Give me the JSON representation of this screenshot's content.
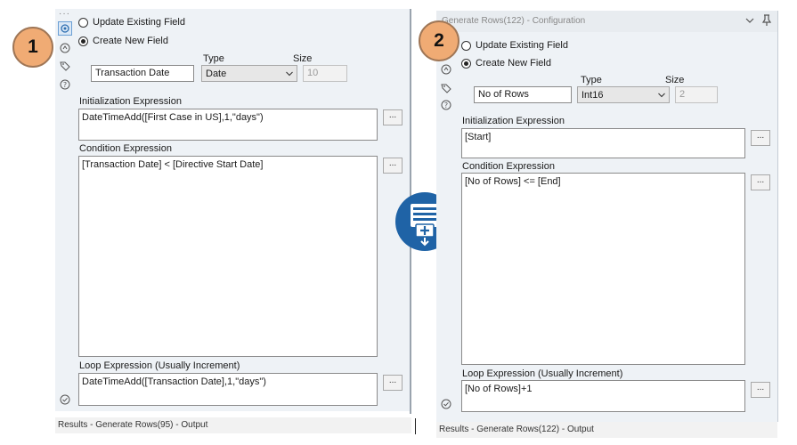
{
  "left": {
    "badge": "1",
    "radio_update": "Update Existing Field",
    "radio_create": "Create New  Field",
    "type_label": "Type",
    "size_label": "Size",
    "field_name": "Transaction Date",
    "type_value": "Date",
    "size_value": "10",
    "init_label": "Initialization Expression",
    "init_value": "DateTimeAdd([First Case in US],1,\"days\")",
    "cond_label": "Condition Expression",
    "cond_value": "[Transaction Date] < [Directive Start Date]",
    "loop_label": "Loop Expression (Usually Increment)",
    "loop_value": "DateTimeAdd([Transaction Date],1,\"days\")",
    "button_label": "...",
    "status": "Results - Generate Rows(95) - Output"
  },
  "right": {
    "badge": "2",
    "header_title": "Generate Rows(122) - Configuration",
    "radio_update": "Update Existing Field",
    "radio_create": "Create New  Field",
    "type_label": "Type",
    "size_label": "Size",
    "field_name": "No of Rows",
    "type_value": "Int16",
    "size_value": "2",
    "init_label": "Initialization Expression",
    "init_value": "[Start]",
    "cond_label": "Condition Expression",
    "cond_value": "[No of Rows] <= [End]",
    "loop_label": "Loop Expression (Usually Increment)",
    "loop_value": "[No of Rows]+1",
    "button_label": "...",
    "status": "Results - Generate Rows(122) - Output"
  },
  "colors": {
    "panel_bg": "#eef2f6",
    "badge_fill": "#f0ab74",
    "tool_icon_blue": "#1f63a6"
  }
}
